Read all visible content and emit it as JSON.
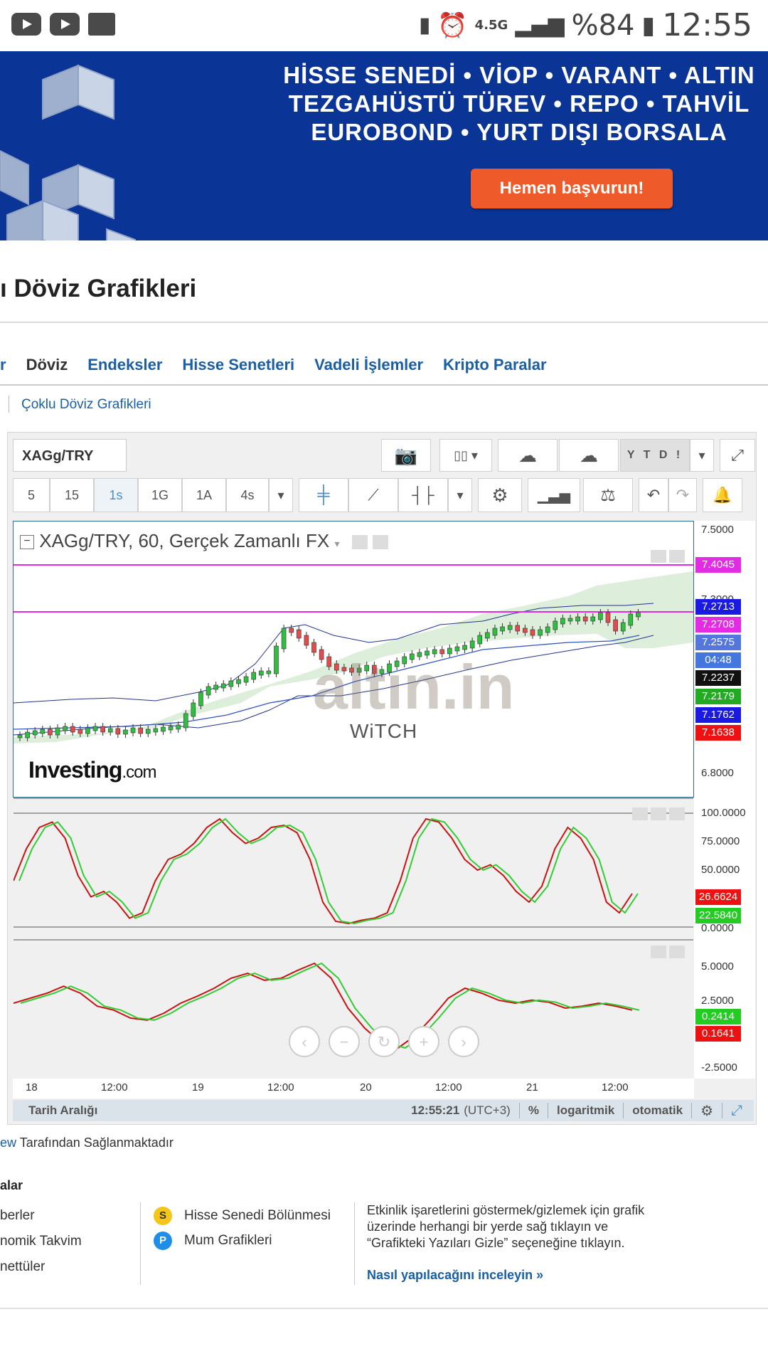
{
  "status_bar": {
    "network": "4.5G",
    "battery": "%84",
    "time": "12:55"
  },
  "banner": {
    "line1": "HİSSE SENEDİ • VİOP • VARANT • ALTIN",
    "line2": "TEZGAHÜSTÜ TÜREV • REPO • TAHVİL",
    "line3": "EUROBOND • YURT DIŞI BORSALA",
    "cta": "Hemen başvurun!"
  },
  "page": {
    "title": "ı Döviz Grafikleri",
    "tabs": [
      "r",
      "Döviz",
      "Endeksler",
      "Hisse Senetleri",
      "Vadeli İşlemler",
      "Kripto Paralar"
    ],
    "active_tab": "Döviz",
    "sublink": "Çoklu Döviz Grafikleri"
  },
  "toolbar": {
    "symbol": "XAGg/TRY",
    "ytd": "Y T D !",
    "timeframes": [
      "5",
      "15",
      "1s",
      "1G",
      "1A",
      "4s"
    ],
    "active_timeframe": "1s"
  },
  "chart": {
    "title": "XAGg/TRY, 60, Gerçek Zamanlı FX",
    "watermark": "altın.in",
    "watermark_sub": "WiTCH",
    "logo": "Investing",
    "logo_suffix": ".com",
    "price_axis": [
      "7.5000",
      "7.3000",
      "6.8000"
    ],
    "price_labels": [
      {
        "text": "7.4045",
        "color": "#e22be2"
      },
      {
        "text": "7.2713",
        "color": "#1a1ae0"
      },
      {
        "text": "7.2708",
        "color": "#e22be2"
      },
      {
        "text": "7.2575",
        "color": "#5577dd"
      },
      {
        "text": "04:48",
        "color": "#4477dd"
      },
      {
        "text": "7.2237",
        "color": "#111111"
      },
      {
        "text": "7.2179",
        "color": "#22aa22"
      },
      {
        "text": "7.1762",
        "color": "#1a1ae0"
      },
      {
        "text": "7.1638",
        "color": "#ee1111"
      }
    ],
    "stoch_axis": [
      "100.0000",
      "75.0000",
      "50.0000",
      "0.0000"
    ],
    "stoch_labels": [
      {
        "text": "26.6624",
        "color": "#ee1111"
      },
      {
        "text": "22.5840",
        "color": "#22cc22"
      }
    ],
    "macd_axis": [
      "5.0000",
      "2.5000",
      "-2.5000"
    ],
    "macd_labels": [
      {
        "text": "0.2414",
        "color": "#22cc22"
      },
      {
        "text": "0.1641",
        "color": "#ee1111"
      }
    ],
    "x_labels": [
      "18",
      "12:00",
      "19",
      "12:00",
      "20",
      "12:00",
      "21",
      "12:00"
    ]
  },
  "footer_bar": {
    "date_range": "Tarih Aralığı",
    "clock": "12:55:21",
    "tz": "(UTC+3)",
    "percent": "%",
    "log": "logaritmik",
    "auto": "otomatik"
  },
  "credit": {
    "link": "ew",
    "text": " Tarafından Sağlanmaktadır"
  },
  "legend": {
    "title": "alar",
    "col1": [
      "berler",
      "nomik Takvim",
      "nettüler"
    ],
    "col2": [
      {
        "badge": "S",
        "label": "Hisse Senedi Bölünmesi",
        "color": "#f5c518"
      },
      {
        "badge": "P",
        "label": "Mum Grafikleri",
        "color": "#1e8ee8"
      }
    ],
    "info": "Etkinlik işaretlerini göstermek/gizlemek için grafik üzerinde herhangi bir yerde sağ tıklayın ve “Grafikteki Yazıları Gizle” seçeneğine tıklayın.",
    "info_link": "Nasıl yapılacağını inceleyin »"
  }
}
